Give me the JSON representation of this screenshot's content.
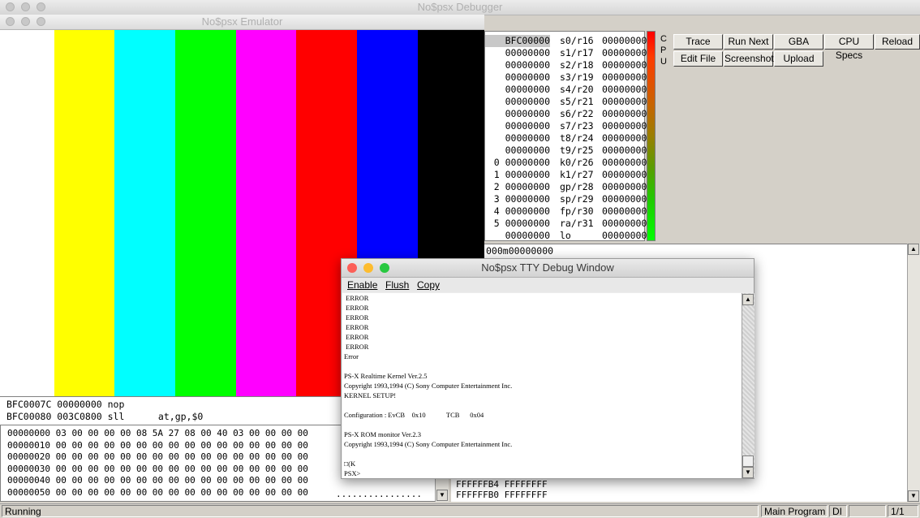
{
  "windows": {
    "debugger_title": "No$psx Debugger",
    "emulator_title": "No$psx Emulator",
    "tty_title": "No$psx TTY Debug Window"
  },
  "emulator": {
    "color_bars": [
      "#ffffff",
      "#ffff00",
      "#00ffff",
      "#00ff00",
      "#ff00ff",
      "#ff0000",
      "#0000ff",
      "#000000"
    ]
  },
  "registers": [
    {
      "left": "BFC00000",
      "reg": "s0/r16",
      "val": "00000000"
    },
    {
      "left": "00000000",
      "reg": "s1/r17",
      "val": "00000000"
    },
    {
      "left": "00000000",
      "reg": "s2/r18",
      "val": "00000000"
    },
    {
      "left": "00000000",
      "reg": "s3/r19",
      "val": "00000000"
    },
    {
      "left": "00000000",
      "reg": "s4/r20",
      "val": "00000000"
    },
    {
      "left": "00000000",
      "reg": "s5/r21",
      "val": "00000000"
    },
    {
      "left": "00000000",
      "reg": "s6/r22",
      "val": "00000000"
    },
    {
      "left": "00000000",
      "reg": "s7/r23",
      "val": "00000000"
    },
    {
      "left": "00000000",
      "reg": "t8/r24",
      "val": "00000000"
    },
    {
      "left": "00000000",
      "reg": "t9/r25",
      "val": "00000000"
    },
    {
      "left": "0 00000000",
      "reg": "k0/r26",
      "val": "00000000"
    },
    {
      "left": "1 00000000",
      "reg": "k1/r27",
      "val": "00000000"
    },
    {
      "left": "2 00000000",
      "reg": "gp/r28",
      "val": "00000000"
    },
    {
      "left": "3 00000000",
      "reg": "sp/r29",
      "val": "00000000"
    },
    {
      "left": "4 00000000",
      "reg": "fp/r30",
      "val": "00000000"
    },
    {
      "left": "5 00000000",
      "reg": "ra/r31",
      "val": "00000000"
    },
    {
      "left": "00000000",
      "reg": "lo",
      "val": "00000000"
    }
  ],
  "cpu_label": [
    "C",
    "P",
    "U"
  ],
  "toolbar": {
    "trace": "Trace",
    "run_next": "Run Next",
    "gba_specs": "GBA Specs",
    "cpu_specs": "CPU Specs",
    "reload": "Reload",
    "edit_file": "Edit File",
    "screenshot": "Screenshot",
    "upload": "Upload"
  },
  "data_line": "000m00000000",
  "disasm": [
    "BFC0007C 00000000 nop",
    "BFC00080 003C0800 sll      at,gp,$0"
  ],
  "hex": [
    "00000000 03 00 00 00 00 08 5A 27 08 00 40 03 00 00 00 00",
    "00000010 00 00 00 00 00 00 00 00 00 00 00 00 00 00 00 00",
    "00000020 00 00 00 00 00 00 00 00 00 00 00 00 00 00 00 00",
    "00000030 00 00 00 00 00 00 00 00 00 00 00 00 00 00 00 00",
    "00000040 00 00 00 00 00 00 00 00 00 00 00 00 00 00 00 00",
    "00000050 00 00 00 00 00 00 00 00 00 00 00 00 00 00 00 00"
  ],
  "hex_ascii_last": "................",
  "stack": [
    "FFFFFFB4 FFFFFFFF",
    "FFFFFFB0 FFFFFFFF"
  ],
  "status": {
    "state": "Running",
    "program": "Main Program",
    "di": "DI",
    "page": "1/1"
  },
  "tty": {
    "menu": {
      "enable": "Enable",
      "flush": "Flush",
      "copy": "Copy"
    },
    "lines": [
      " ERROR",
      " ERROR",
      " ERROR",
      " ERROR",
      " ERROR",
      " ERROR",
      "Error",
      "",
      "PS-X Realtime Kernel Ver.2.5",
      "Copyright 1993,1994 (C) Sony Computer Entertainment Inc.",
      "KERNEL SETUP!",
      "",
      "Configuration : EvCB    0x10            TCB      0x04",
      "",
      "PS-X ROM monitor Ver.2.3",
      "Copyright 1993,1994 (C) Sony Computer Entertainment Inc.",
      "",
      "□(K",
      "PSX>"
    ]
  }
}
